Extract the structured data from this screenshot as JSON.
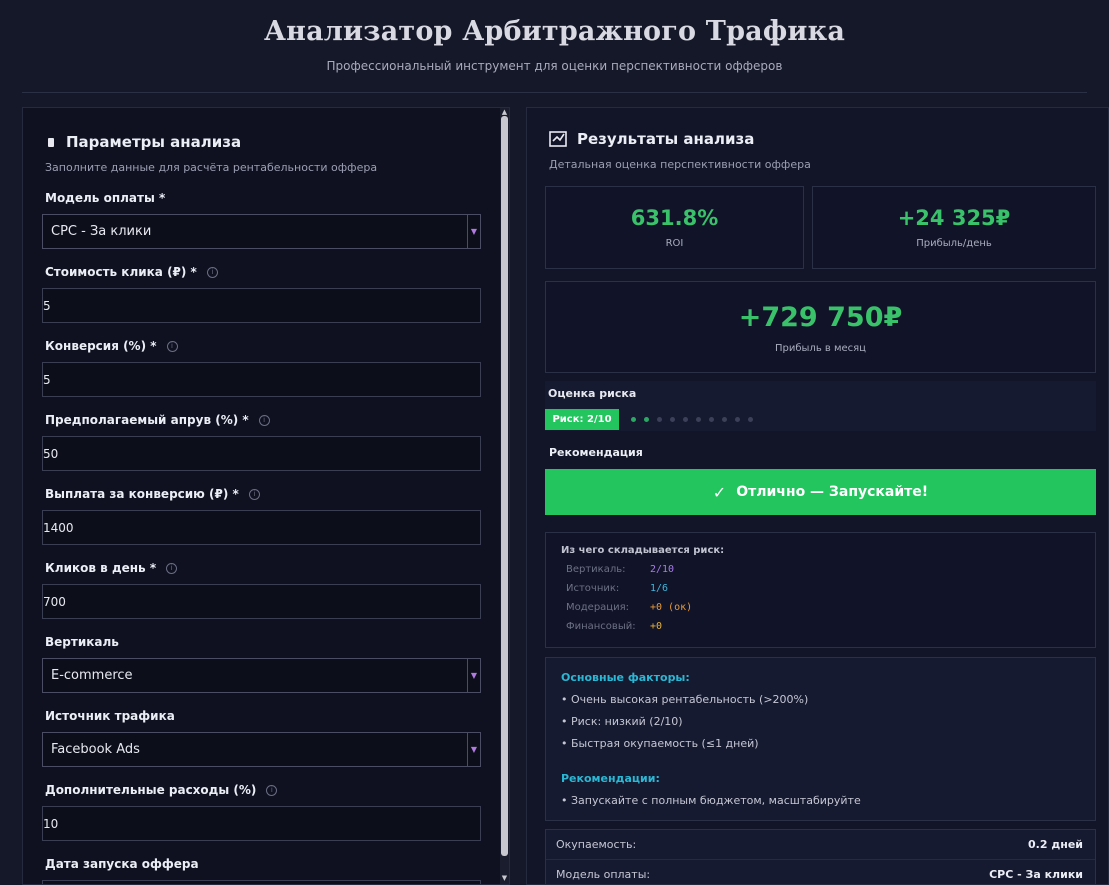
{
  "header": {
    "title": "Анализатор Арбитражного Трафика",
    "subtitle": "Профессиональный инструмент для оценки перспективности офферов"
  },
  "params": {
    "title": "Параметры анализа",
    "description": "Заполните данные для расчёта рентабельности оффера",
    "fields": [
      {
        "label": "Модель оплаты *",
        "type": "select",
        "value": "CPC - За клики",
        "info": false
      },
      {
        "label": "Стоимость клика (₽) *",
        "type": "input",
        "value": "5",
        "info": true
      },
      {
        "label": "Конверсия (%) *",
        "type": "input",
        "value": "5",
        "info": true
      },
      {
        "label": "Предполагаемый апрув (%) *",
        "type": "input",
        "value": "50",
        "info": true
      },
      {
        "label": "Выплата за конверсию (₽) *",
        "type": "input",
        "value": "1400",
        "info": true
      },
      {
        "label": "Кликов в день *",
        "type": "input",
        "value": "700",
        "info": true
      },
      {
        "label": "Вертикаль",
        "type": "select",
        "value": "E-commerce",
        "info": false
      },
      {
        "label": "Источник трафика",
        "type": "select",
        "value": "Facebook Ads",
        "info": false
      },
      {
        "label": "Дополнительные расходы (%)",
        "type": "input",
        "value": "10",
        "info": true
      },
      {
        "label": "Дата запуска оффера",
        "type": "input",
        "value": "",
        "info": false
      }
    ]
  },
  "results": {
    "title": "Результаты анализа",
    "description": "Детальная оценка перспективности оффера",
    "roi": {
      "value": "631.8%",
      "label": "ROI"
    },
    "profit_day": {
      "value": "+24 325₽",
      "label": "Прибыль/день"
    },
    "profit_month": {
      "value": "+729 750₽",
      "label": "Прибыль в месяц"
    },
    "risk": {
      "title": "Оценка риска",
      "badge": "Риск: 2/10",
      "score": 2,
      "max": 10
    },
    "recommendation": {
      "title": "Рекомендация",
      "text": "Отлично — Запускайте!",
      "check": "✓"
    },
    "breakdown": {
      "title": "Из чего складывается риск:",
      "rows": [
        {
          "key": "Вертикаль:",
          "value": "2/10",
          "color": "#a77be8"
        },
        {
          "key": "Источник:",
          "value": "1/6",
          "color": "#3fb6dc"
        },
        {
          "key": "Модерация:",
          "value": "+0 (ок)",
          "color": "#e69a3a"
        },
        {
          "key": "Финансовый:",
          "value": "+0",
          "color": "#e8b23a"
        }
      ]
    },
    "factors": {
      "main_title": "Основные факторы:",
      "main_items": [
        "• Очень высокая рентабельность (>200%)",
        "• Риск: низкий (2/10)",
        "• Быстрая окупаемость (≤1 дней)"
      ],
      "rec_title": "Рекомендации:",
      "rec_items": [
        "• Запускайте с полным бюджетом, масштабируйте"
      ]
    },
    "summary": [
      {
        "key": "Окупаемость:",
        "value": "0.2 дней"
      },
      {
        "key": "Модель оплаты:",
        "value": "CPC - За клики"
      }
    ]
  },
  "colors": {
    "accent_green": "#22c55e",
    "accent_purple": "#b07adf",
    "accent_cyan": "#2bb8d4"
  }
}
